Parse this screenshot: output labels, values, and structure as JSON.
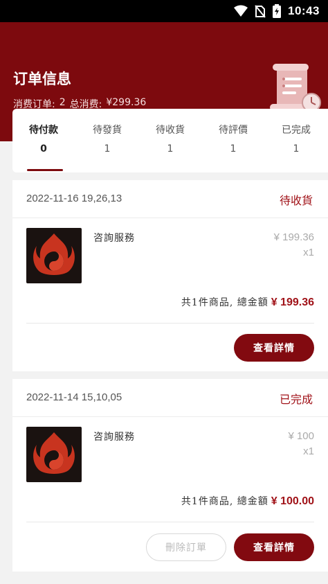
{
  "status_bar": {
    "time": "10:43",
    "icons": [
      "wifi-icon",
      "no-sim-icon",
      "battery-charging-icon"
    ]
  },
  "header": {
    "title": "订单信息",
    "orders_label": "消费订单:",
    "orders_count": "2",
    "total_label": "总消费:",
    "total_value": "¥299.36",
    "decor_icon": "receipt-scroll-clock-icon"
  },
  "tabs": [
    {
      "label": "待付款",
      "count": "0",
      "active": true
    },
    {
      "label": "待發貨",
      "count": "1",
      "active": false
    },
    {
      "label": "待收貨",
      "count": "1",
      "active": false
    },
    {
      "label": "待評價",
      "count": "1",
      "active": false
    },
    {
      "label": "已完成",
      "count": "1",
      "active": false
    }
  ],
  "orders": [
    {
      "date": "2022-11-16 19,26,13",
      "status": "待收貨",
      "product_name": "咨詢服務",
      "price": "¥ 199.36",
      "qty": "x1",
      "summary_text": "共1件商品, 總金額",
      "summary_amount": "¥ 199.36",
      "buttons": {
        "detail": "查看詳情"
      }
    },
    {
      "date": "2022-11-14 15,10,05",
      "status": "已完成",
      "product_name": "咨詢服務",
      "price": "¥ 100",
      "qty": "x1",
      "summary_text": "共1件商品, 總金額",
      "summary_amount": "¥ 100.00",
      "buttons": {
        "delete": "刪除訂單",
        "detail": "查看詳情"
      }
    }
  ],
  "colors": {
    "brand": "#7d0a0e",
    "accent_text": "#a01218",
    "muted": "#aaaaaa"
  }
}
